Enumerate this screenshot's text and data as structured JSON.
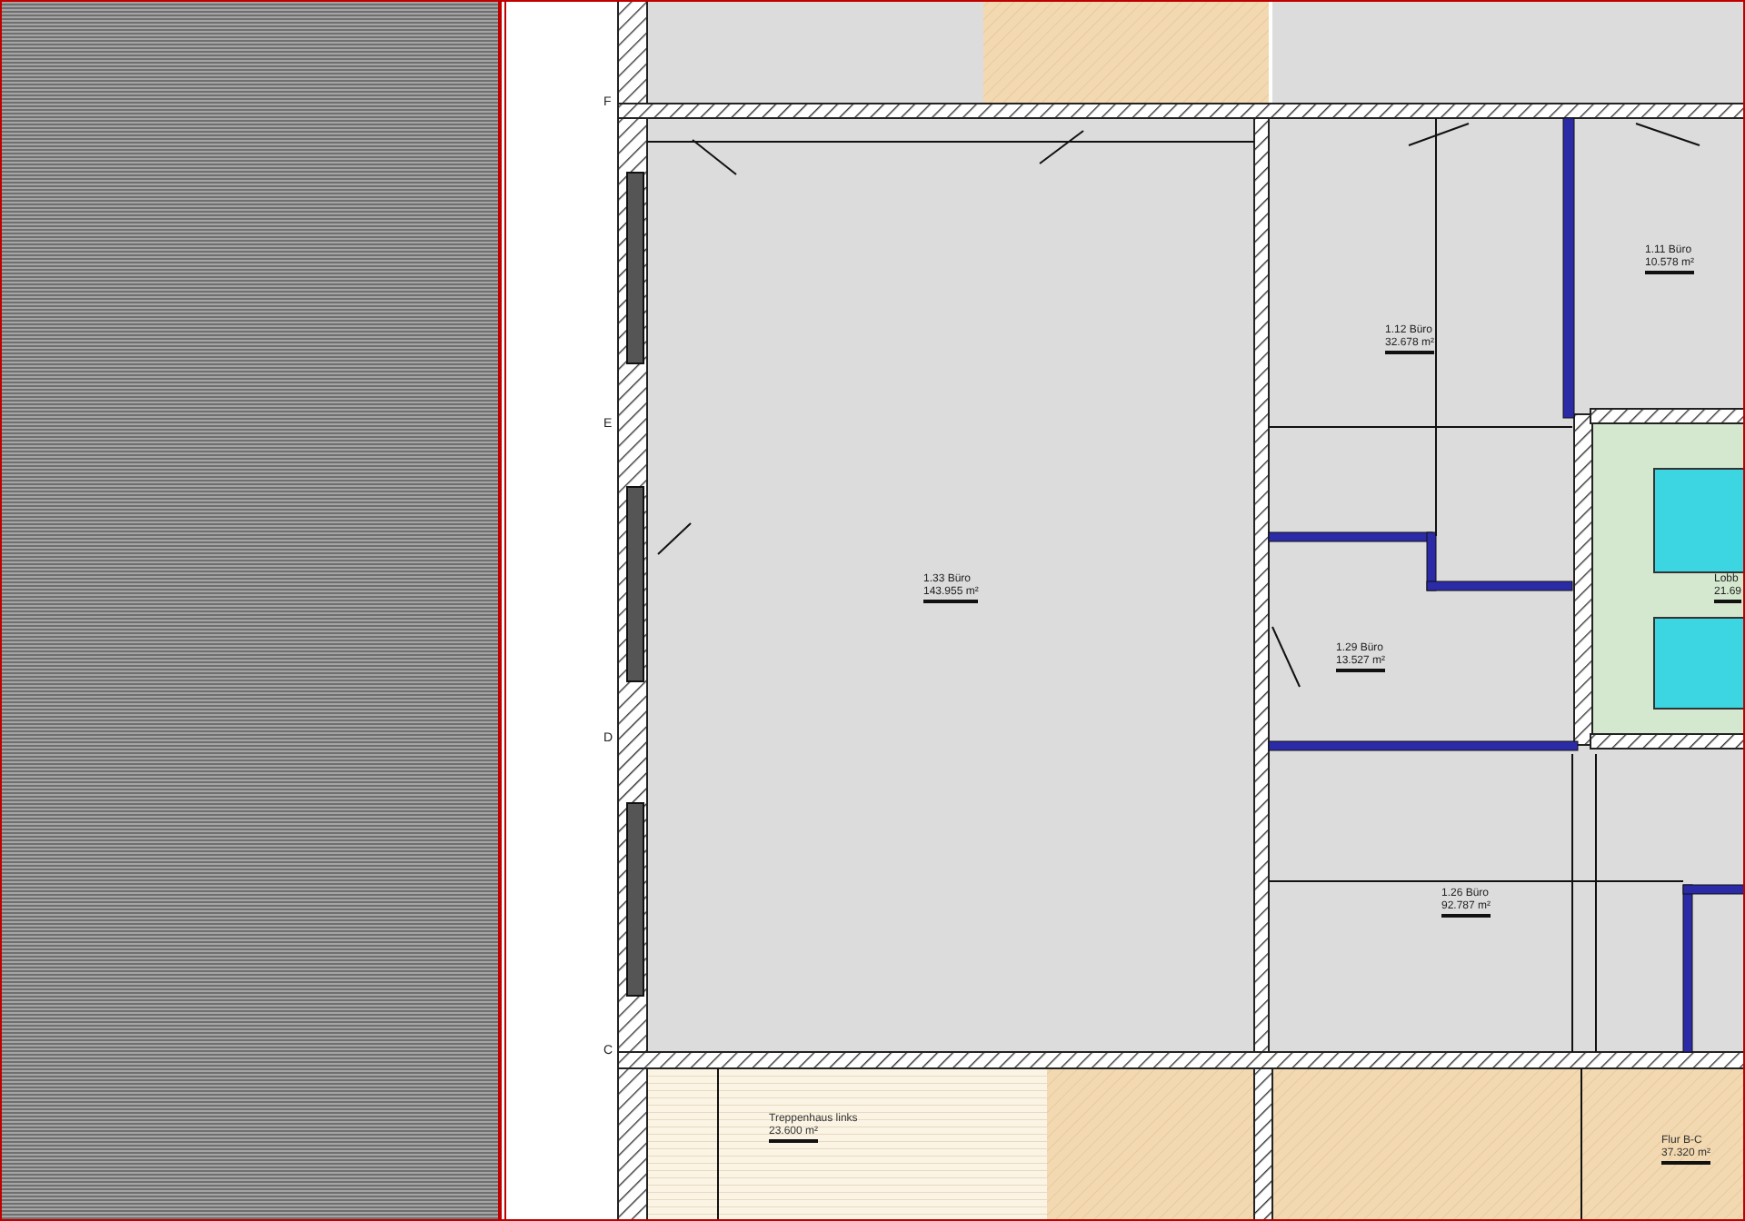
{
  "grid_marks": [
    {
      "label": "F"
    },
    {
      "label": "E"
    },
    {
      "label": "D"
    },
    {
      "label": "C"
    }
  ],
  "rooms": [
    {
      "name": "1.33 Büro",
      "area": "143.955 m²",
      "kind": "office"
    },
    {
      "name": "1.12 Büro",
      "area": "32.678 m²",
      "kind": "office"
    },
    {
      "name": "1.11 Büro",
      "area": "10.578 m²",
      "kind": "office"
    },
    {
      "name": "Lobb",
      "area": "21.69",
      "kind": "lobby"
    },
    {
      "name": "1.29 Büro",
      "area": "13.527 m²",
      "kind": "office"
    },
    {
      "name": "1.26 Büro",
      "area": "92.787 m²",
      "kind": "office"
    },
    {
      "name": "Treppenhaus links",
      "area": "23.600 m²",
      "kind": "stair"
    },
    {
      "name": "Flur B-C",
      "area": "37.320 m²",
      "kind": "corridor"
    }
  ]
}
